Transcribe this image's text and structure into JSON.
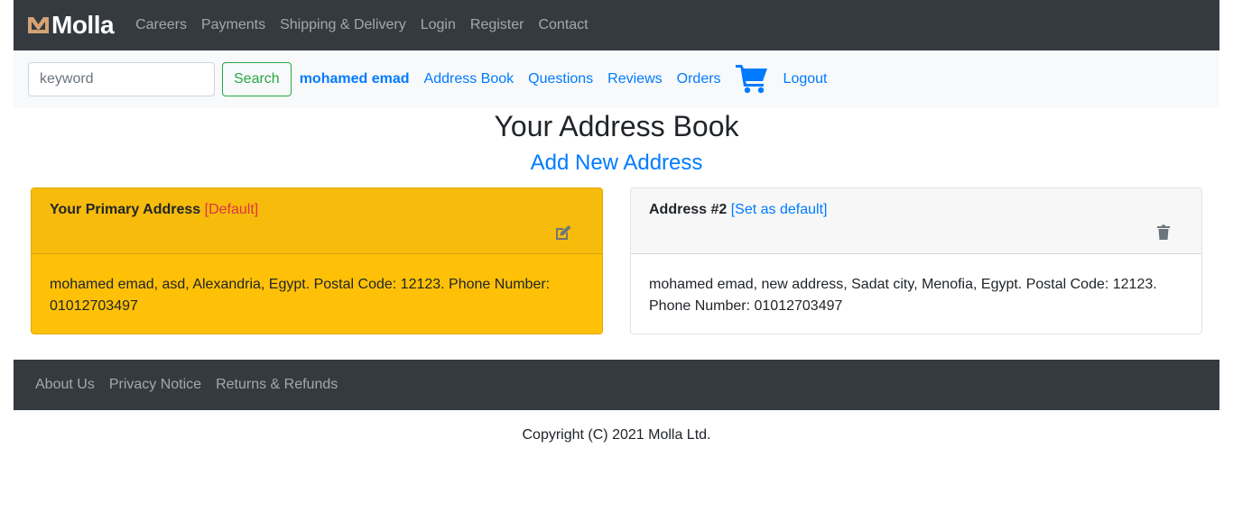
{
  "brand": {
    "name": "Molla",
    "accent": "#d4a373"
  },
  "topnav": {
    "links": [
      "Careers",
      "Payments",
      "Shipping & Delivery",
      "Login",
      "Register",
      "Contact"
    ]
  },
  "subnav": {
    "search_placeholder": "keyword",
    "search_label": "Search",
    "username": "mohamed emad",
    "links": [
      "Address Book",
      "Questions",
      "Reviews",
      "Orders"
    ],
    "logout": "Logout"
  },
  "main": {
    "title": "Your Address Book",
    "add_link": "Add New Address",
    "addresses": [
      {
        "title": "Your Primary Address",
        "tag": "[Default]",
        "text": "mohamed emad, asd, Alexandria, Egypt. Postal Code: 12123. Phone Number: 01012703497",
        "action_icon": "edit-icon"
      },
      {
        "title": "Address #2",
        "tag": "[Set as default]",
        "text": "mohamed emad, new address, Sadat city, Menofia, Egypt. Postal Code: 12123. Phone Number: 01012703497",
        "action_icon": "trash-icon"
      }
    ]
  },
  "footer": {
    "links": [
      "About Us",
      "Privacy Notice",
      "Returns & Refunds"
    ],
    "copyright": "Copyright (C) 2021 Molla Ltd."
  },
  "colors": {
    "primary_link": "#007bff",
    "warning": "#ffc107",
    "dark": "#343a40",
    "danger": "#dc3545",
    "success": "#28a745"
  }
}
